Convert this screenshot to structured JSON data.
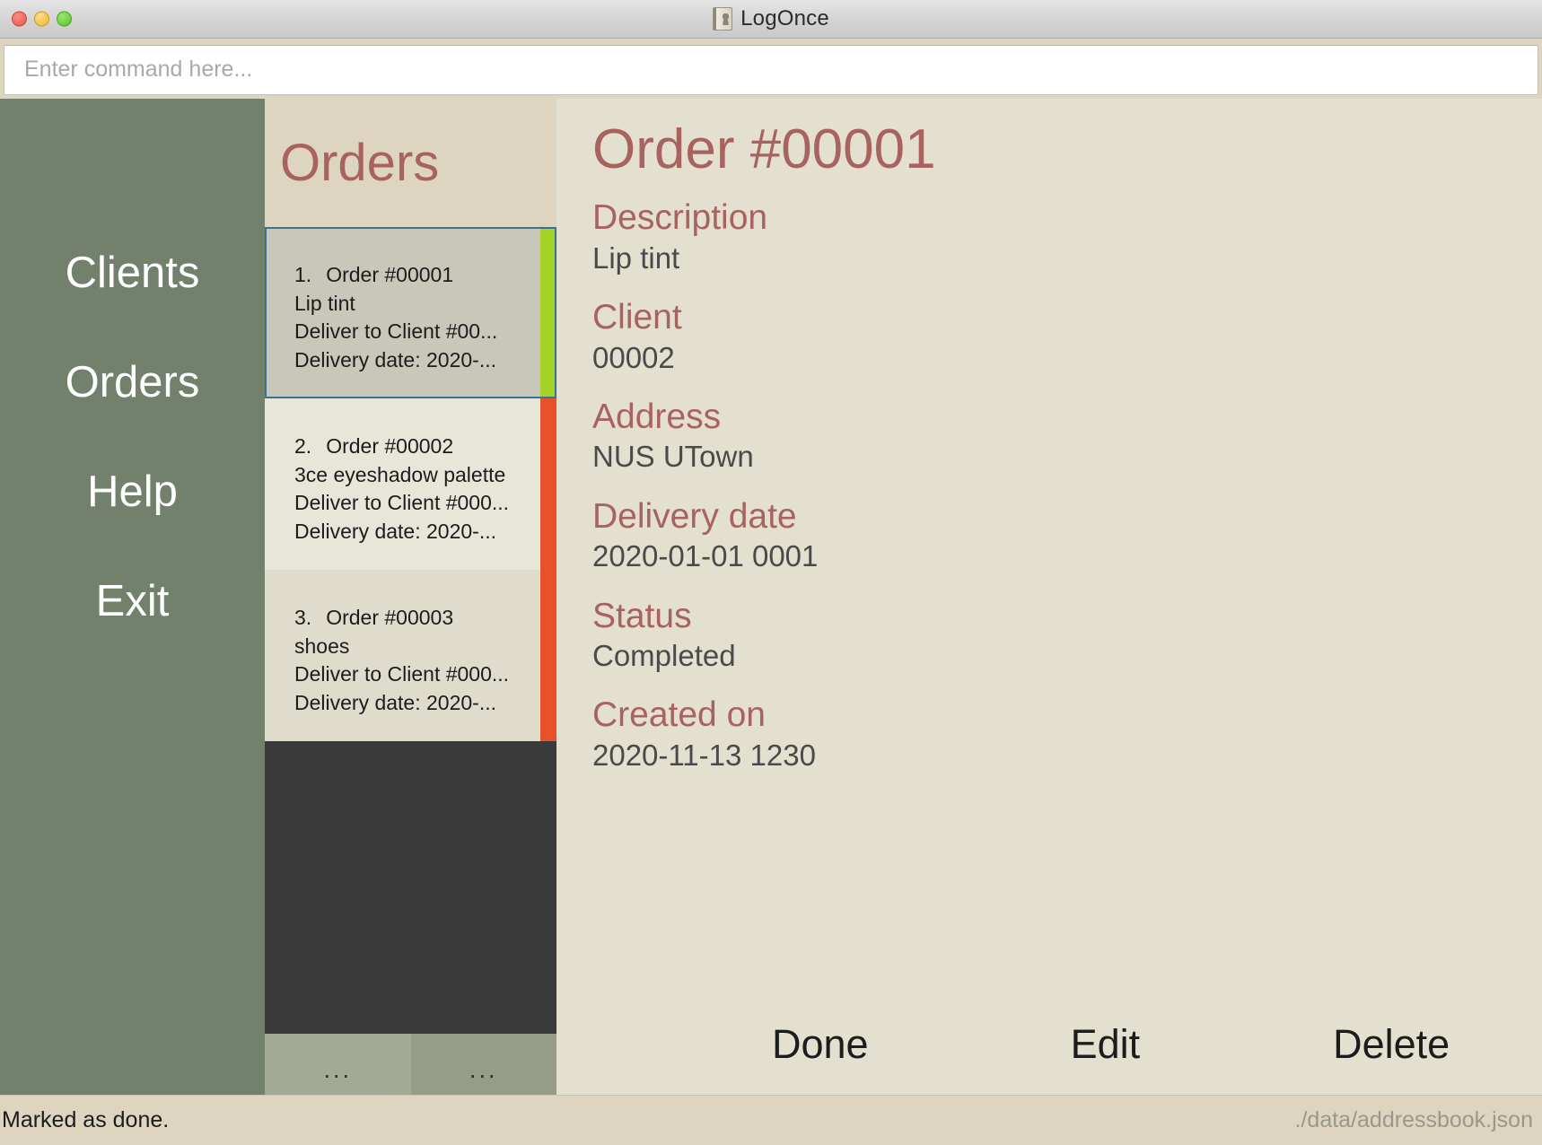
{
  "window": {
    "title": "LogOnce",
    "icon": "address-book-icon",
    "traffic_lights": [
      "close",
      "minimize",
      "maximize"
    ]
  },
  "command": {
    "value": "",
    "placeholder": "Enter command here..."
  },
  "sidebar": {
    "items": [
      {
        "label": "Clients"
      },
      {
        "label": "Orders"
      },
      {
        "label": "Help"
      },
      {
        "label": "Exit"
      }
    ]
  },
  "list": {
    "title": "Orders",
    "pagination": {
      "prev_label": "...",
      "next_label": "..."
    },
    "cards": [
      {
        "index": "1.",
        "title": "Order #00001",
        "description": "Lip tint",
        "client_line": "Deliver to Client #00...",
        "date_line": "Delivery date: 2020-...",
        "status_color": "#a5d227",
        "selected": true
      },
      {
        "index": "2.",
        "title": "Order #00002",
        "description": "3ce eyeshadow palette",
        "client_line": "Deliver to Client #000...",
        "date_line": "Delivery date: 2020-...",
        "status_color": "#e8522a",
        "selected": false
      },
      {
        "index": "3.",
        "title": "Order #00003",
        "description": "shoes",
        "client_line": "Deliver to Client #000...",
        "date_line": "Delivery date: 2020-...",
        "status_color": "#e8522a",
        "selected": false
      }
    ]
  },
  "detail": {
    "title": "Order #00001",
    "fields": [
      {
        "label": "Description",
        "value": "Lip tint"
      },
      {
        "label": "Client",
        "value": "00002"
      },
      {
        "label": "Address",
        "value": "NUS UTown"
      },
      {
        "label": "Delivery date",
        "value": "2020-01-01 0001"
      },
      {
        "label": "Status",
        "value": "Completed"
      },
      {
        "label": "Created on",
        "value": "2020-11-13 1230"
      }
    ],
    "actions": [
      {
        "label": "Done"
      },
      {
        "label": "Edit"
      },
      {
        "label": "Delete"
      }
    ]
  },
  "statusbar": {
    "message": "Marked as done.",
    "path": "./data/addressbook.json"
  },
  "colors": {
    "accent_heading": "#a8625f",
    "sidebar_bg": "#73806c",
    "panel_bg": "#e3e0cf",
    "header_bg": "#ddd5bf",
    "selection_border": "#3a7390",
    "status_green": "#a5d227",
    "status_red": "#e8522a"
  }
}
